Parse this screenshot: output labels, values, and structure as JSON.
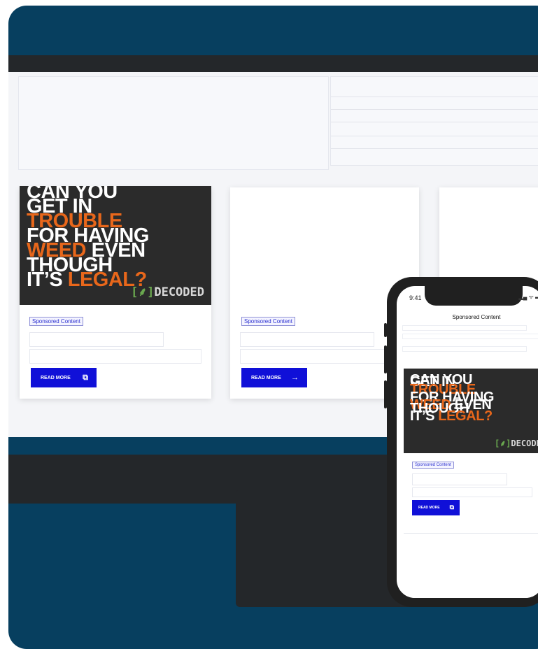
{
  "cards": [
    {
      "headline": [
        "CAN YOU",
        "GET IN",
        "TROUBLE",
        "FOR HAVING",
        "WEED",
        "EVEN",
        "THOUGH",
        "IT’S",
        "LEGAL?"
      ],
      "logo": "DECODED",
      "logo_bracket": "[⸙]",
      "badge": "Sponsored Content",
      "button_label": "READ MORE",
      "button_icon": "external-link-icon"
    },
    {
      "badge": "Sponsored Content",
      "button_label": "READ MORE",
      "button_icon": "arrow-right-icon"
    }
  ],
  "phone": {
    "time": "9:41",
    "status": "▂▄ ᯤ ▬",
    "title": "Sponsored Content",
    "badge": "Sponsored Content",
    "button_label": "READ MORE",
    "headline": [
      "CAN YOU",
      "GET IN",
      "TROUBLE",
      "FOR HAVING",
      "WEED",
      "EVEN",
      "THOUGH",
      "IT’S",
      "LEGAL?"
    ],
    "logo": "DECODED",
    "logo_bracket": "[⸙]"
  },
  "colors": {
    "frame": "#073f5f",
    "bar": "#24272a",
    "accent": "#e8671b",
    "button": "#1010d8"
  }
}
